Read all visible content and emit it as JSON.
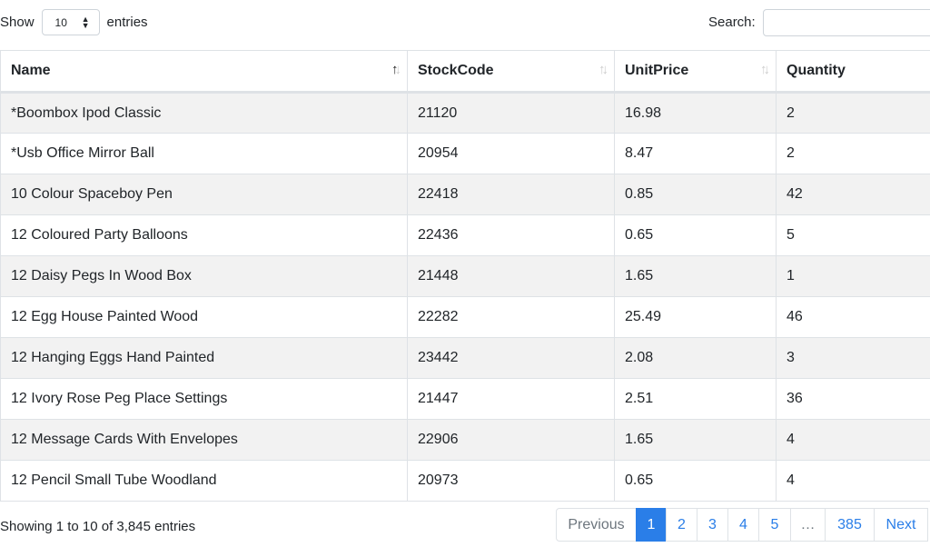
{
  "length": {
    "show_label": "Show",
    "value": "10",
    "entries_label": "entries"
  },
  "search": {
    "label": "Search:",
    "value": ""
  },
  "columns": [
    "Name",
    "StockCode",
    "UnitPrice",
    "Quantity"
  ],
  "sort": {
    "column": "Name",
    "direction": "asc"
  },
  "rows": [
    [
      "*Boombox Ipod Classic",
      "21120",
      "16.98",
      "2"
    ],
    [
      "*Usb Office Mirror Ball",
      "20954",
      "8.47",
      "2"
    ],
    [
      "10 Colour Spaceboy Pen",
      "22418",
      "0.85",
      "42"
    ],
    [
      "12 Coloured Party Balloons",
      "22436",
      "0.65",
      "5"
    ],
    [
      "12 Daisy Pegs In Wood Box",
      "21448",
      "1.65",
      "1"
    ],
    [
      "12 Egg House Painted Wood",
      "22282",
      "25.49",
      "46"
    ],
    [
      "12 Hanging Eggs Hand Painted",
      "23442",
      "2.08",
      "3"
    ],
    [
      "12 Ivory Rose Peg Place Settings",
      "21447",
      "2.51",
      "36"
    ],
    [
      "12 Message Cards With Envelopes",
      "22906",
      "1.65",
      "4"
    ],
    [
      "12 Pencil Small Tube Woodland",
      "20973",
      "0.65",
      "4"
    ]
  ],
  "info": "Showing 1 to 10 of 3,845 entries",
  "pagination": {
    "previous": "Previous",
    "pages": [
      "1",
      "2",
      "3",
      "4",
      "5",
      "…",
      "385"
    ],
    "current": "1",
    "next": "Next"
  },
  "colors": {
    "accent": "#2a7ee8"
  }
}
